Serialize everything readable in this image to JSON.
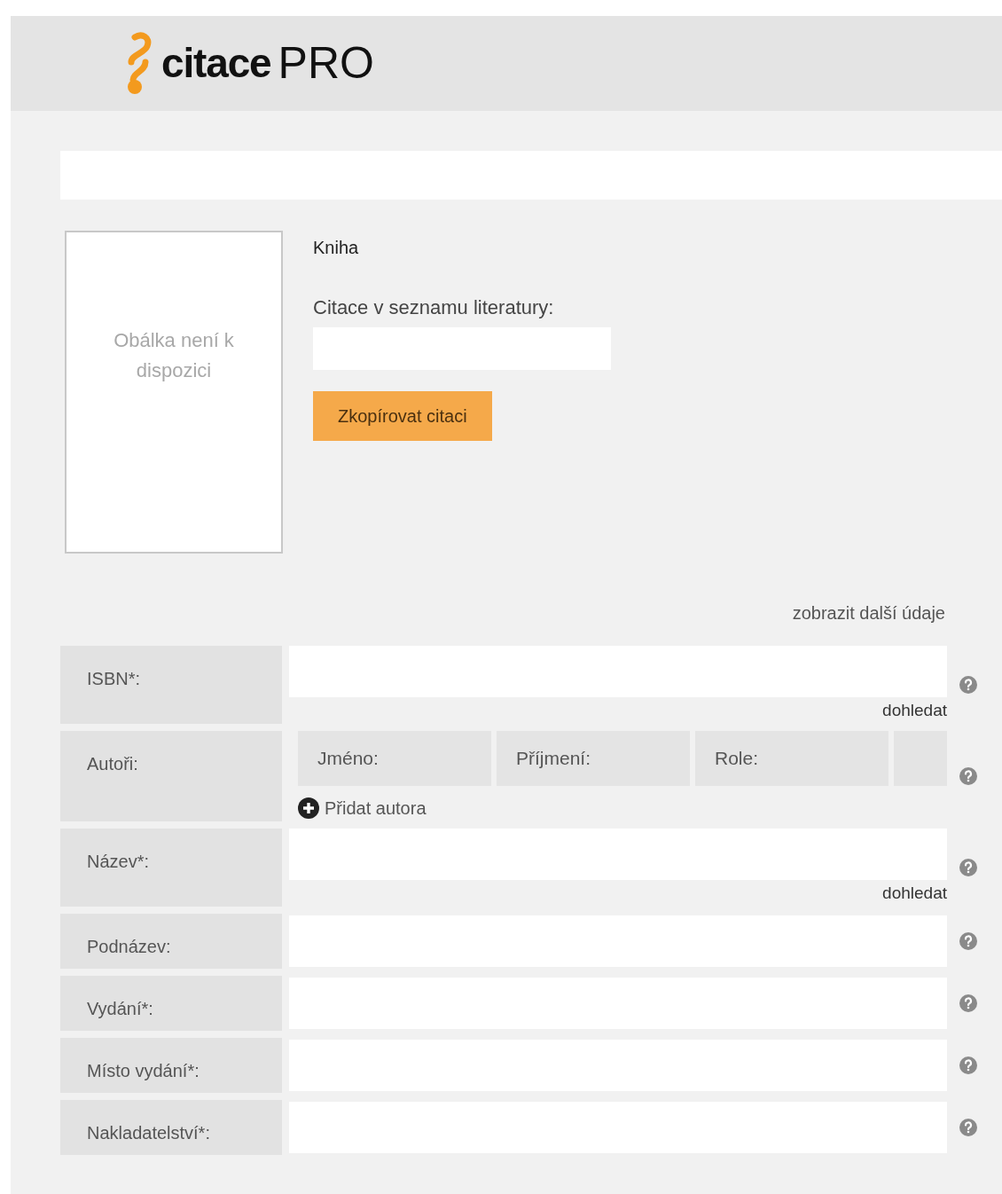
{
  "header": {
    "logo_word": "citace",
    "logo_suffix": "PRO"
  },
  "cover": {
    "placeholder": "Obálka není k dispozici"
  },
  "record": {
    "type": "Kniha",
    "citation_label": "Citace v seznamu literatury:",
    "copy_button": "Zkopírovat citaci"
  },
  "more_link": "zobrazit další údaje",
  "fields": [
    {
      "kind": "field",
      "label": "ISBN*:",
      "lookup": "dohledat"
    },
    {
      "kind": "authors",
      "label": "Autoři:",
      "columns": [
        "Jméno:",
        "Příjmení:",
        "Role:"
      ],
      "add_button": "Přidat autora"
    },
    {
      "kind": "field",
      "label": "Název*:",
      "lookup": "dohledat"
    },
    {
      "kind": "field",
      "label": "Podnázev:"
    },
    {
      "kind": "field",
      "label": "Vydání*:"
    },
    {
      "kind": "field",
      "label": "Místo vydání*:"
    },
    {
      "kind": "field",
      "label": "Nakladatelství*:"
    }
  ]
}
